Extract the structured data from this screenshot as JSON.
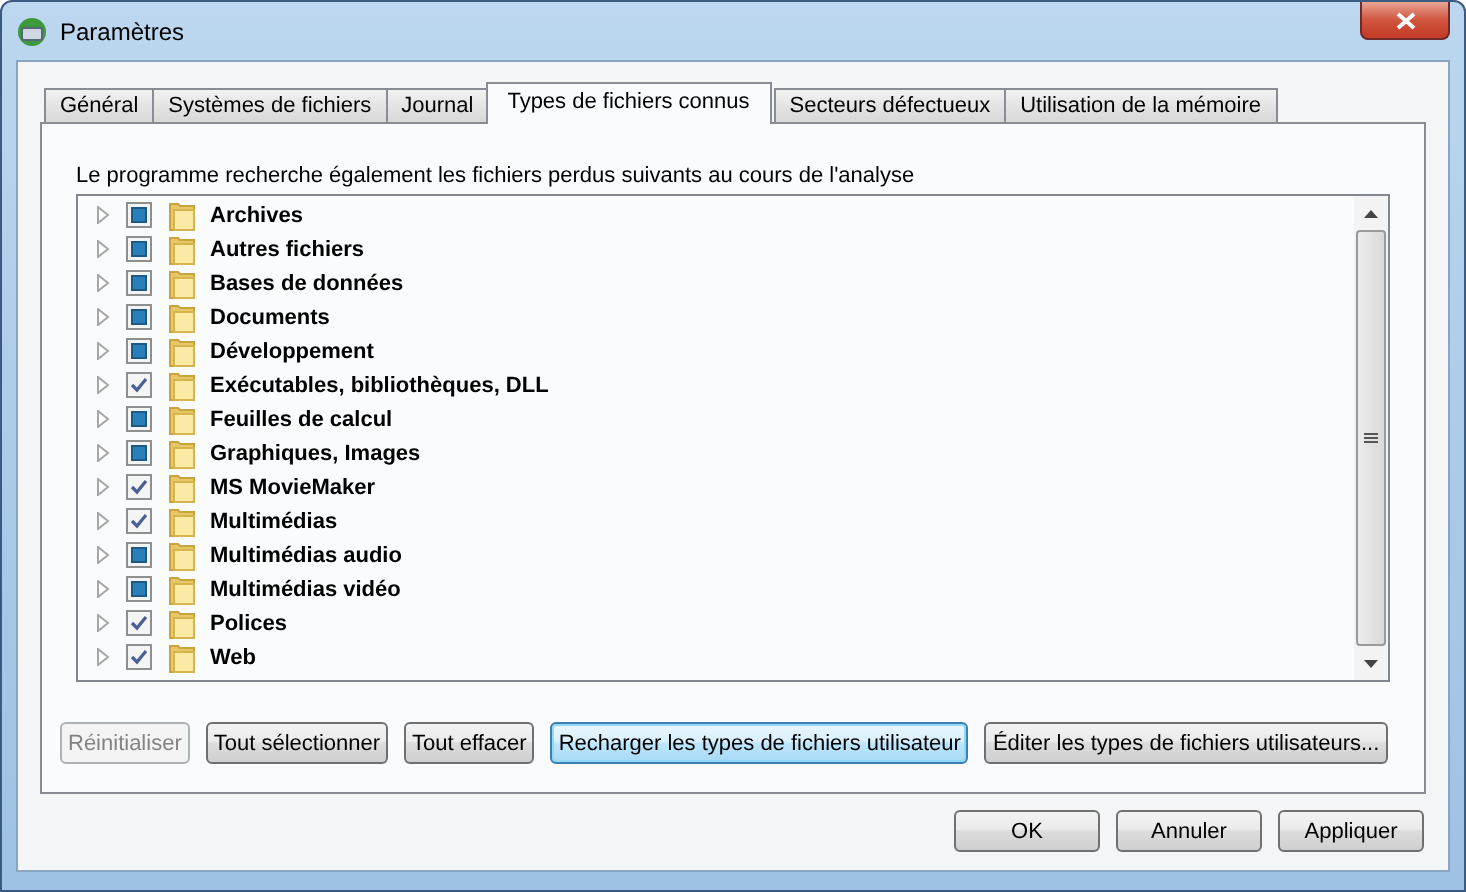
{
  "window": {
    "title": "Paramètres"
  },
  "tabs": [
    {
      "label": "Général",
      "selected": false
    },
    {
      "label": "Systèmes de fichiers",
      "selected": false
    },
    {
      "label": "Journal",
      "selected": false
    },
    {
      "label": "Types de fichiers connus",
      "selected": true
    },
    {
      "label": "Secteurs défectueux",
      "selected": false
    },
    {
      "label": "Utilisation de la mémoire",
      "selected": false
    }
  ],
  "description": "Le programme recherche également les fichiers perdus suivants au cours de l'analyse",
  "file_types": [
    {
      "label": "Archives",
      "checked": false,
      "partial": true
    },
    {
      "label": "Autres fichiers",
      "checked": false,
      "partial": true
    },
    {
      "label": "Bases de données",
      "checked": false,
      "partial": true
    },
    {
      "label": "Documents",
      "checked": false,
      "partial": true
    },
    {
      "label": "Développement",
      "checked": false,
      "partial": true
    },
    {
      "label": "Exécutables, bibliothèques, DLL",
      "checked": true,
      "partial": false
    },
    {
      "label": "Feuilles de calcul",
      "checked": false,
      "partial": true
    },
    {
      "label": "Graphiques, Images",
      "checked": false,
      "partial": true
    },
    {
      "label": "MS MovieMaker",
      "checked": true,
      "partial": false
    },
    {
      "label": "Multimédias",
      "checked": true,
      "partial": false
    },
    {
      "label": "Multimédias audio",
      "checked": false,
      "partial": true
    },
    {
      "label": "Multimédias vidéo",
      "checked": false,
      "partial": true
    },
    {
      "label": "Polices",
      "checked": true,
      "partial": false
    },
    {
      "label": "Web",
      "checked": true,
      "partial": false
    }
  ],
  "panel_buttons": [
    {
      "label": "Réinitialiser",
      "disabled": true,
      "focused": false
    },
    {
      "label": "Tout sélectionner",
      "disabled": false,
      "focused": false
    },
    {
      "label": "Tout effacer",
      "disabled": false,
      "focused": false
    },
    {
      "label": "Recharger les types de fichiers utilisateur",
      "disabled": false,
      "focused": true
    },
    {
      "label": "Éditer les types de fichiers utilisateurs...",
      "disabled": false,
      "focused": false
    }
  ],
  "dialog_buttons": [
    {
      "label": "OK"
    },
    {
      "label": "Annuler"
    },
    {
      "label": "Appliquer"
    }
  ]
}
